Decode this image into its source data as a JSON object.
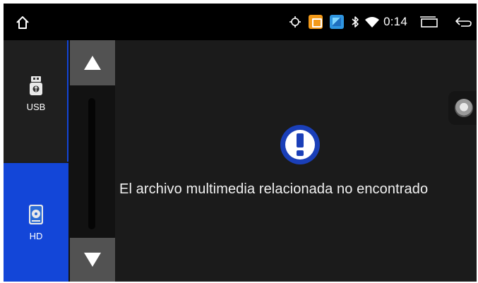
{
  "status_bar": {
    "time": "0:14",
    "icons": [
      "home-icon",
      "gps-icon",
      "orange-app-icon",
      "blue-app-icon",
      "bluetooth-icon",
      "wifi-icon",
      "recents-icon",
      "back-icon"
    ]
  },
  "sidebar": {
    "sources": [
      {
        "label": "USB",
        "icon": "usb-drive-icon",
        "selected": false
      },
      {
        "label": "HD",
        "icon": "hard-disk-icon",
        "selected": true
      }
    ]
  },
  "scroll": {
    "up_icon": "triangle-up-icon",
    "down_icon": "triangle-down-icon"
  },
  "main": {
    "alert_icon": "exclamation-icon",
    "message": "El archivo multimedia relacionada no encontrado"
  },
  "colors": {
    "selected_source": "#1346d8",
    "alert_blue": "#1a3fb8",
    "status_bar_bg": "#000000",
    "app_orange": "#f39a1a",
    "app_blue": "#2f95e0"
  }
}
